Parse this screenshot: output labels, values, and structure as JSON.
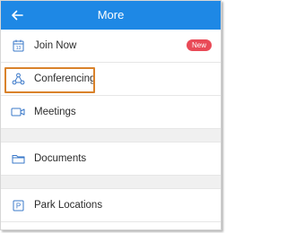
{
  "header": {
    "title": "More",
    "color": "#1e88e5"
  },
  "items": [
    {
      "label": "Join Now",
      "icon": "calendar-icon",
      "badge": "New",
      "calendar_day": "13"
    },
    {
      "label": "Conferencing",
      "icon": "share-icon",
      "highlighted": true
    },
    {
      "label": "Meetings",
      "icon": "video-camera-icon"
    },
    {
      "label": "Documents",
      "icon": "folder-icon"
    },
    {
      "label": "Park Locations",
      "icon": "parking-icon",
      "icon_text": "P"
    }
  ],
  "colors": {
    "accent": "#1e88e5",
    "icon": "#3a78c9",
    "badge": "#e94a57",
    "highlight": "#d9822b"
  }
}
